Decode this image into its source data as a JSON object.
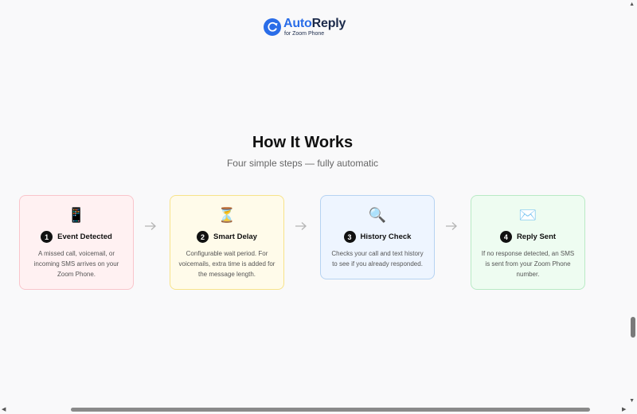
{
  "logo": {
    "name_part1": "Auto",
    "name_part2": "Reply",
    "subtitle": "for Zoom Phone",
    "color": "#2a6de8"
  },
  "section": {
    "title": "How It Works",
    "subtitle": "Four simple steps — fully automatic"
  },
  "steps": [
    {
      "number": "1",
      "icon": "📱",
      "icon_name": "phone-icon",
      "title": "Event Detected",
      "description": "A missed call, voicemail, or incoming SMS arrives on your Zoom Phone.",
      "bg": "#fff1f2",
      "border": "#f9c5cb"
    },
    {
      "number": "2",
      "icon": "⏳",
      "icon_name": "hourglass-icon",
      "title": "Smart Delay",
      "description": "Configurable wait period. For voicemails, extra time is added for the message length.",
      "bg": "#fffbea",
      "border": "#f7e38a"
    },
    {
      "number": "3",
      "icon": "🔍",
      "icon_name": "magnifier-icon",
      "title": "History Check",
      "description": "Checks your call and text history to see if you already responded.",
      "bg": "#eef5ff",
      "border": "#b6d3f2"
    },
    {
      "number": "4",
      "icon": "✉️",
      "icon_name": "envelope-icon",
      "title": "Reply Sent",
      "description": "If no response detected, an SMS is sent from your Zoom Phone number.",
      "bg": "#eefcf1",
      "border": "#b9eac5"
    }
  ]
}
